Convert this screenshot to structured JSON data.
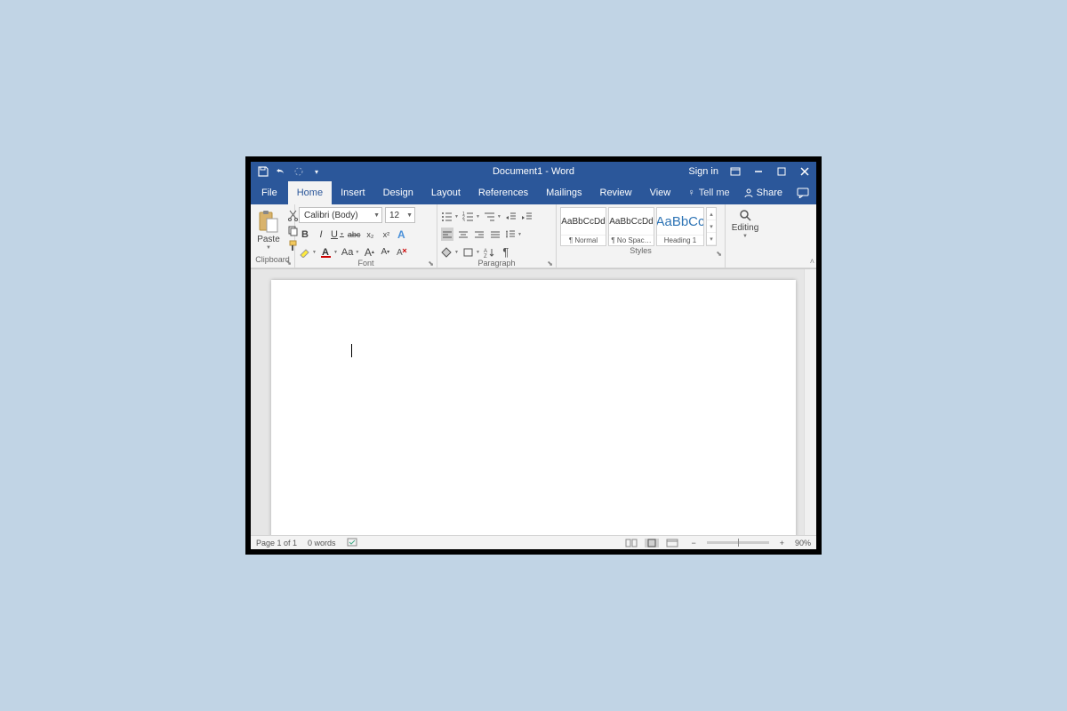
{
  "titlebar": {
    "title": "Document1 - Word",
    "signin": "Sign in"
  },
  "tabs": {
    "file": "File",
    "home": "Home",
    "insert": "Insert",
    "design": "Design",
    "layout": "Layout",
    "references": "References",
    "mailings": "Mailings",
    "review": "Review",
    "view": "View",
    "tellme": "Tell me",
    "share": "Share"
  },
  "ribbon": {
    "clipboard": {
      "label": "Clipboard",
      "paste": "Paste"
    },
    "font": {
      "label": "Font",
      "name": "Calibri (Body)",
      "size": "12",
      "bold": "B",
      "italic": "I",
      "underline": "U",
      "strike": "abc",
      "sub": "x₂",
      "sup": "x²",
      "caseAa": "Aa",
      "growA": "A",
      "shrinkA": "A"
    },
    "paragraph": {
      "label": "Paragraph"
    },
    "styles": {
      "label": "Styles",
      "preview1": "AaBbCcDd",
      "name1": "¶ Normal",
      "preview2": "AaBbCcDd",
      "name2": "¶ No Spac…",
      "preview3": "AaBbCc",
      "name3": "Heading 1"
    },
    "editing": {
      "label": "Editing"
    }
  },
  "statusbar": {
    "page": "Page 1 of 1",
    "words": "0 words",
    "zoom": "90%"
  }
}
